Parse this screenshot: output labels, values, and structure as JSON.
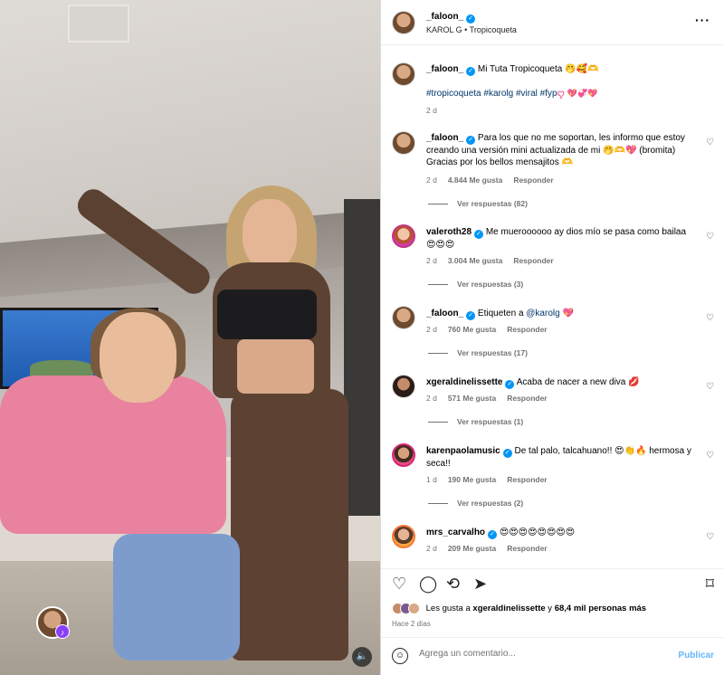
{
  "post": {
    "author": "_faloon_",
    "audio": "KAROL G • Tropicoqueta",
    "caption_user": "_faloon_",
    "caption_text": "Mi Tuta Tropicoqueta 🤭🥰🫶",
    "hashtags": "#tropicoqueta #karolg #viral #fyp",
    "hashtag_emojis": "ꨄ 💖💞💖",
    "time": "2 d"
  },
  "comments": [
    {
      "user": "_faloon_",
      "text": "Para los que no me soportan, les informo que estoy creando una versión mini actualizada de mi 🤭🫶💖 (bromita) Gracias por los bellos mensajitos 🫶",
      "time": "2 d",
      "likes": "4.844 Me gusta",
      "reply": "Responder",
      "replies": "Ver respuestas (82)"
    },
    {
      "user": "valeroth28",
      "text": "Me mueroooooo ay dios mío se pasa como bailaa 😍😍😍",
      "time": "2 d",
      "likes": "3.004 Me gusta",
      "reply": "Responder",
      "replies": "Ver respuestas (3)"
    },
    {
      "user": "_faloon_",
      "text_prefix": "Etiqueten a ",
      "mention": "@karolg",
      "text_suffix": " 💖",
      "time": "2 d",
      "likes": "760 Me gusta",
      "reply": "Responder",
      "replies": "Ver respuestas (17)"
    },
    {
      "user": "xgeraldinelissette",
      "text": "Acaba de nacer a new diva 💋",
      "time": "2 d",
      "likes": "571 Me gusta",
      "reply": "Responder",
      "replies": "Ver respuestas (1)"
    },
    {
      "user": "karenpaolamusic",
      "text": "De tal palo, talcahuano!! 😍👏🔥 hermosa y seca!!",
      "time": "1 d",
      "likes": "190 Me gusta",
      "reply": "Responder",
      "replies": "Ver respuestas (2)"
    },
    {
      "user": "mrs_carvalho",
      "text": "😍😍😍😍😍😍😍😍",
      "time": "2 d",
      "likes": "209 Me gusta",
      "reply": "Responder"
    }
  ],
  "likes_summary": {
    "prefix": "Les gusta a ",
    "user": "xgeraldinelissette",
    "middle": " y ",
    "count": "68,4 mil personas más"
  },
  "posted_ago": "Hace 2 días",
  "composer": {
    "placeholder": "Agrega un comentario...",
    "publish": "Publicar"
  },
  "icons": {
    "like": "heart-icon",
    "comment": "comment-icon",
    "share": "repost-icon",
    "send": "send-icon",
    "save": "bookmark-icon",
    "more": "more-icon",
    "emoji": "emoji-icon",
    "audio": "speaker-icon"
  },
  "colors": {
    "link": "#00376b",
    "verified": "#0095f6",
    "publish": "#67b5fa",
    "muted": "#737373"
  }
}
